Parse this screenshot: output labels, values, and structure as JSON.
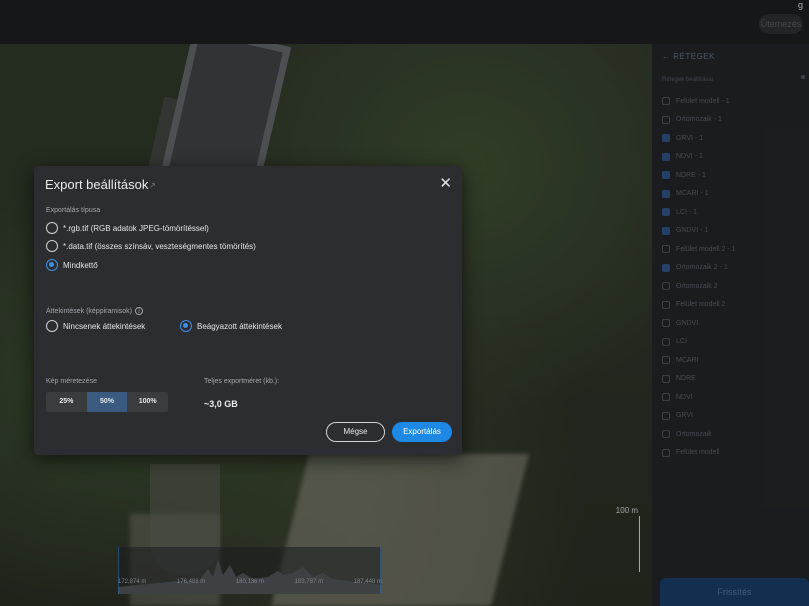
{
  "topbar": {
    "button_label": "Ütemezés",
    "corner_text": "g"
  },
  "map": {
    "scale_label": "100 m",
    "profile_ticks": [
      "172,874 m",
      "176,488 m",
      "180,136 m",
      "183,787 m",
      "187,448 m"
    ]
  },
  "sidebar": {
    "header": "RÉTEGEK",
    "subheader": "Rétegek beállításai",
    "items": [
      {
        "label": "Felület modell - 1",
        "checked": false
      },
      {
        "label": "Ortomozaik - 1",
        "checked": false
      },
      {
        "label": "GRVI - 1",
        "checked": true
      },
      {
        "label": "NDVI - 1",
        "checked": true
      },
      {
        "label": "NDRE - 1",
        "checked": true
      },
      {
        "label": "MCARI - 1",
        "checked": true
      },
      {
        "label": "LCI - 1",
        "checked": true
      },
      {
        "label": "GNDVI - 1",
        "checked": true
      },
      {
        "label": "Felület modell 2 - 1",
        "checked": false
      },
      {
        "label": "Ortomozaik 2 - 1",
        "checked": true
      },
      {
        "label": "Ortomozaik 2",
        "checked": false
      },
      {
        "label": "Felület modell 2",
        "checked": false
      },
      {
        "label": "GNDVI",
        "checked": false
      },
      {
        "label": "LCI",
        "checked": false
      },
      {
        "label": "MCARI",
        "checked": false
      },
      {
        "label": "NDRE",
        "checked": false
      },
      {
        "label": "NDVI",
        "checked": false
      },
      {
        "label": "GRVI",
        "checked": false
      },
      {
        "label": "Ortomozaik",
        "checked": false
      },
      {
        "label": "Felület modell",
        "checked": false
      }
    ],
    "footer_label": "Frissítés"
  },
  "dialog": {
    "title": "Export beállítások",
    "link_icon": "↗",
    "close_icon": "✕",
    "export_type_label": "Exportálás típusa",
    "export_types": [
      {
        "label": "*.rgb.tif (RGB adatok JPEG-tömörítéssel)",
        "selected": false
      },
      {
        "label": "*.data.tif (összes színsáv, veszteségmentes tömörítés)",
        "selected": false
      },
      {
        "label": "Mindkettő",
        "selected": true
      }
    ],
    "overviews_label": "Áttekintések (képpiramisok)",
    "overview_options": [
      {
        "label": "Nincsenek áttekintések",
        "selected": false
      },
      {
        "label": "Beágyazott áttekintések",
        "selected": true
      }
    ],
    "resize_label": "Kép méretezése",
    "resize_options": [
      {
        "label": "25%",
        "selected": false
      },
      {
        "label": "50%",
        "selected": true
      },
      {
        "label": "100%",
        "selected": false
      }
    ],
    "total_label": "Teljes exportméret (kb.):",
    "total_value": "~3,0 GB",
    "cancel_label": "Mégse",
    "export_label": "Exportálás"
  }
}
